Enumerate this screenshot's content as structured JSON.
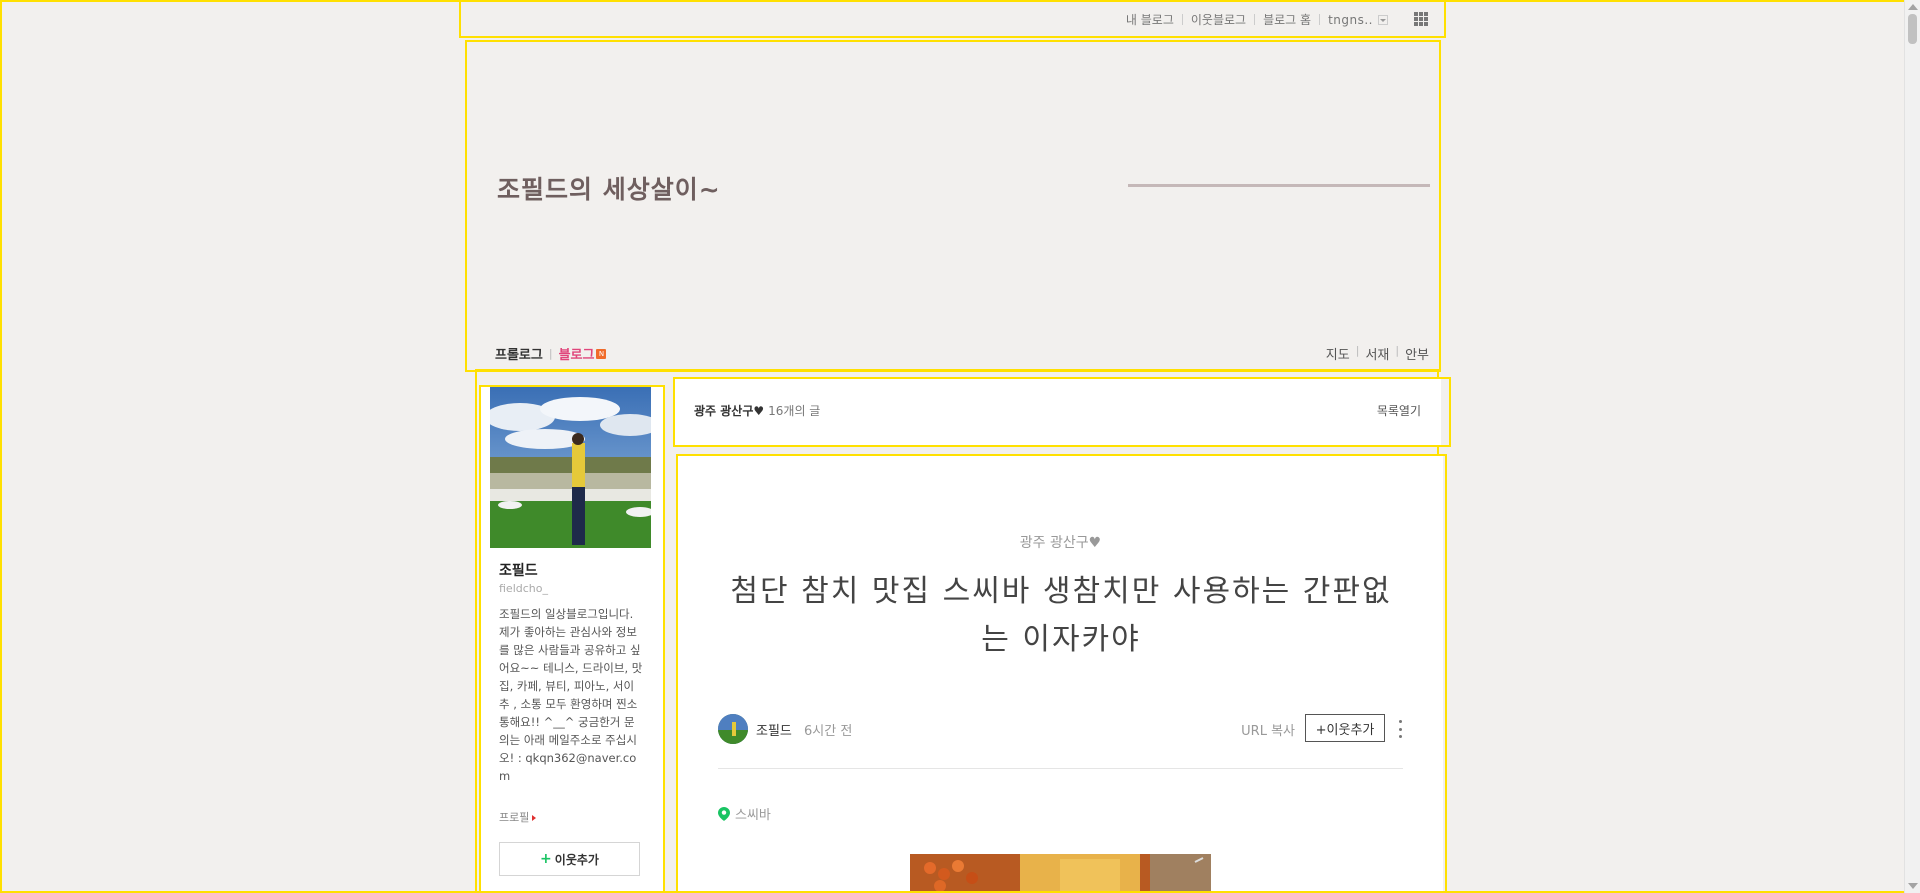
{
  "topbar": {
    "links": [
      "내 블로그",
      "이웃블로그",
      "블로그 홈"
    ],
    "user": "tngns..",
    "apps_icon": "apps-grid-icon"
  },
  "header": {
    "blog_title": "조필드의 세상살이~",
    "nav_left": {
      "prologue": "프롤로그",
      "blog": "블로그",
      "badge": "N"
    },
    "nav_right": [
      "지도",
      "서재",
      "안부"
    ]
  },
  "profile": {
    "name": "조필드",
    "id": "fieldcho_",
    "description": "조필드의 일상블로그입니다.    제가 좋아하는 관심사와 정보를 많은 사람들과 공유하고 싶어요~~   테니스, 드라이브, 맛집, 카페, 뷰티, 피아노, 서이추 , 소통 모두 환영하며 찐소통해요!! ^__^ 궁금한거 문의는 아래 메일주소로 주십시오! : qkqn362@naver.com",
    "link": "프로필",
    "follow_label": "이웃추가"
  },
  "category_bar": {
    "name": "광주 광산구♥",
    "count": "16개의 글",
    "open_list": "목록열기"
  },
  "post": {
    "category": "광주 광산구♥",
    "title": "첨단 참치 맛집 스씨바 생참치만 사용하는 간판없는 이자카야",
    "author": "조필드",
    "time": "6시간 전",
    "url_copy": "URL 복사",
    "neighbor_add": "+이웃추가",
    "place": "스씨바"
  },
  "colors": {
    "highlight_border": "#ffe000",
    "blog_active": "#e0457b",
    "follow_plus": "#19c463",
    "pin": "#19c463"
  }
}
